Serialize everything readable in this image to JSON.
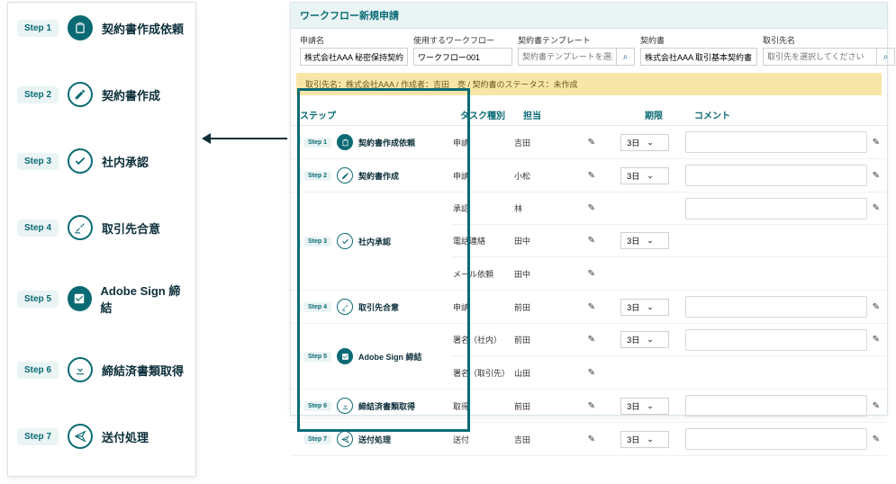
{
  "left_steps": [
    {
      "pill": "Step 1",
      "label": "契約書作成依頼",
      "icon": "clipboard",
      "solid": true
    },
    {
      "pill": "Step 2",
      "label": "契約書作成",
      "icon": "pencil",
      "solid": false
    },
    {
      "pill": "Step 3",
      "label": "社内承認",
      "icon": "check",
      "solid": false
    },
    {
      "pill": "Step 4",
      "label": "取引先合意",
      "icon": "gavel",
      "solid": false
    },
    {
      "pill": "Step 5",
      "label": "Adobe Sign 締結",
      "icon": "checkbox",
      "solid": true
    },
    {
      "pill": "Step 6",
      "label": "締結済書類取得",
      "icon": "download",
      "solid": false
    },
    {
      "pill": "Step 7",
      "label": "送付処理",
      "icon": "send",
      "solid": false
    }
  ],
  "panel": {
    "title": "ワークフロー新規申請",
    "filters": {
      "name_label": "申請名",
      "name_value": "株式会社AAA 秘密保持契約書",
      "workflow_label": "使用するワークフロー",
      "workflow_value": "ワークフロー001",
      "template_label": "契約書テンプレート",
      "template_placeholder": "契約書テンプレートを選択し",
      "contract_label": "契約書",
      "contract_value": "株式会社AAA 取引基本契約書",
      "partner_label": "取引先名",
      "partner_placeholder": "取引先を選択してください"
    },
    "yellow": "取引先名：株式会社AAA / 作成者：吉田　亮 / 契約書のステータス：未作成",
    "columns": {
      "step": "ステップ",
      "task": "タスク種別",
      "person": "担当",
      "period": "期限",
      "comment": "コメント"
    },
    "rows": [
      {
        "pill": "Step 1",
        "label": "契約書作成依頼",
        "icon": "clipboard",
        "solid": true,
        "tasks": [
          {
            "task": "申請",
            "person": "吉田",
            "period": "3日"
          }
        ]
      },
      {
        "pill": "Step 2",
        "label": "契約書作成",
        "icon": "pencil",
        "solid": false,
        "tasks": [
          {
            "task": "申請",
            "person": "小松",
            "period": "3日"
          }
        ]
      },
      {
        "pill": "Step 3",
        "label": "社内承認",
        "icon": "check",
        "solid": false,
        "tasks": [
          {
            "task": "承認",
            "person": "林",
            "period": null
          },
          {
            "task": "電話連絡",
            "person": "田中",
            "period": "3日"
          },
          {
            "task": "メール依頼",
            "person": "田中",
            "period": null
          }
        ]
      },
      {
        "pill": "Step 4",
        "label": "取引先合意",
        "icon": "gavel",
        "solid": false,
        "tasks": [
          {
            "task": "申請",
            "person": "前田",
            "period": "3日"
          }
        ]
      },
      {
        "pill": "Step 5",
        "label": "Adobe Sign 締結",
        "icon": "checkbox",
        "solid": true,
        "tasks": [
          {
            "task": "署名（社内）",
            "person": "前田",
            "period": "3日"
          },
          {
            "task": "署名（取引先）",
            "person": "山田",
            "period": null
          }
        ]
      },
      {
        "pill": "Step 6",
        "label": "締結済書類取得",
        "icon": "download",
        "solid": false,
        "tasks": [
          {
            "task": "取得",
            "person": "前田",
            "period": "3日"
          }
        ]
      },
      {
        "pill": "Step 7",
        "label": "送付処理",
        "icon": "send",
        "solid": false,
        "tasks": [
          {
            "task": "送付",
            "person": "吉田",
            "period": "3日"
          }
        ]
      }
    ]
  }
}
